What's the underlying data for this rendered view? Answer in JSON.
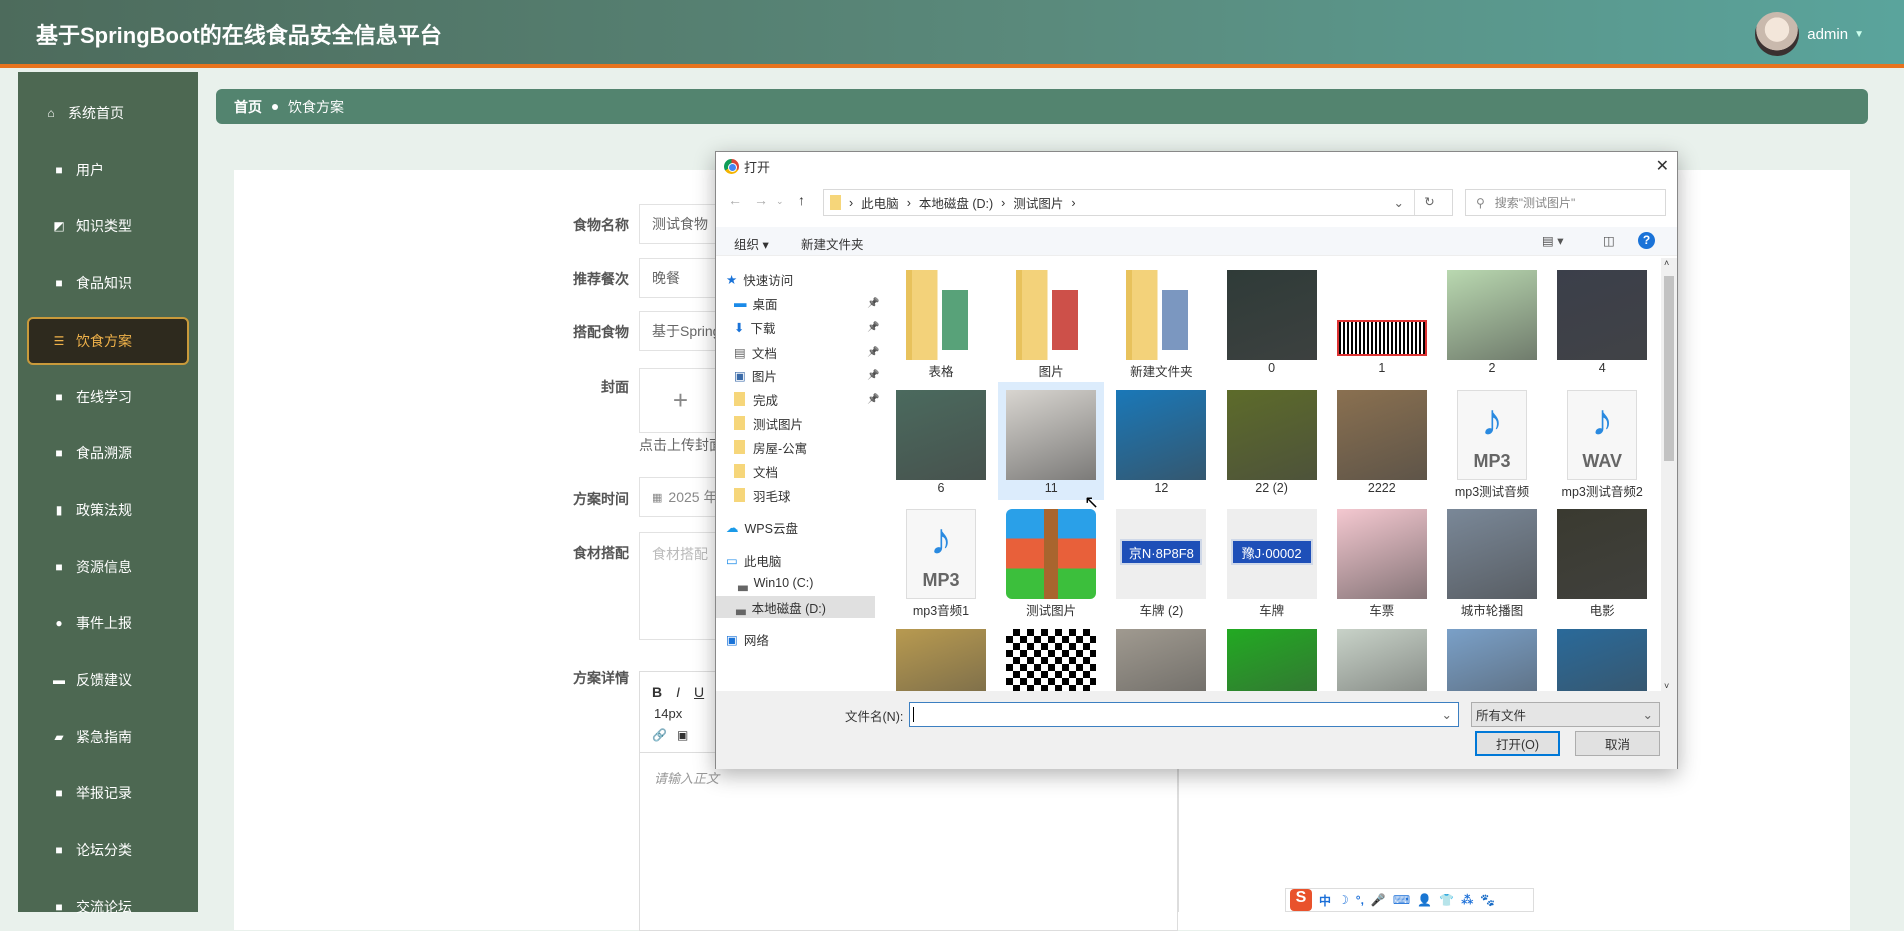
{
  "header": {
    "title": "基于SpringBoot的在线食品安全信息平台",
    "username": "admin"
  },
  "sidebar": {
    "items": [
      {
        "label": "系统首页",
        "icon": "home-icon"
      },
      {
        "label": "用户",
        "icon": "grid-icon"
      },
      {
        "label": "知识类型",
        "icon": "chart-icon"
      },
      {
        "label": "食品知识",
        "icon": "grid-icon"
      },
      {
        "label": "饮食方案",
        "icon": "sliders-icon",
        "active": true
      },
      {
        "label": "在线学习",
        "icon": "grid-icon"
      },
      {
        "label": "食品溯源",
        "icon": "grid-icon"
      },
      {
        "label": "政策法规",
        "icon": "book-icon"
      },
      {
        "label": "资源信息",
        "icon": "grid-icon"
      },
      {
        "label": "事件上报",
        "icon": "user-icon"
      },
      {
        "label": "反馈建议",
        "icon": "printer-icon"
      },
      {
        "label": "紧急指南",
        "icon": "briefcase-icon"
      },
      {
        "label": "举报记录",
        "icon": "grid-icon"
      },
      {
        "label": "论坛分类",
        "icon": "grid-icon"
      },
      {
        "label": "交流论坛",
        "icon": "grid-icon"
      }
    ]
  },
  "breadcrumb": {
    "home": "首页",
    "current": "饮食方案"
  },
  "form": {
    "food_name": {
      "label": "食物名称",
      "value": "测试食物"
    },
    "meal": {
      "label": "推荐餐次",
      "value": "晚餐"
    },
    "pairing": {
      "label": "搭配食物",
      "value": "基于Spring"
    },
    "cover": {
      "label": "封面",
      "hint": "点击上传封面"
    },
    "time": {
      "label": "方案时间",
      "value": "2025 年"
    },
    "ingredients": {
      "label": "食材搭配",
      "placeholder": "食材搭配"
    },
    "detail": {
      "label": "方案详情",
      "font_size": "14px",
      "placeholder": "请输入正文"
    }
  },
  "dialog": {
    "title": "打开",
    "path": [
      "此电脑",
      "本地磁盘 (D:)",
      "测试图片"
    ],
    "search_placeholder": "搜索\"测试图片\"",
    "organize": "组织 ▾",
    "new_folder": "新建文件夹",
    "nav": [
      {
        "label": "快速访问",
        "type": "star"
      },
      {
        "label": "桌面",
        "type": "desktop",
        "pin": true
      },
      {
        "label": "下载",
        "type": "download",
        "pin": true
      },
      {
        "label": "文档",
        "type": "doc",
        "pin": true
      },
      {
        "label": "图片",
        "type": "pic",
        "pin": true
      },
      {
        "label": "完成",
        "type": "folder",
        "pin": true
      },
      {
        "label": "测试图片",
        "type": "folder"
      },
      {
        "label": "房屋-公寓",
        "type": "folder"
      },
      {
        "label": "文档",
        "type": "folder"
      },
      {
        "label": "羽毛球",
        "type": "folder"
      },
      {
        "label": "WPS云盘",
        "type": "cloud"
      },
      {
        "label": "此电脑",
        "type": "pc"
      },
      {
        "label": "Win10 (C:)",
        "type": "drive"
      },
      {
        "label": "本地磁盘 (D:)",
        "type": "drive",
        "selected": true
      },
      {
        "label": "网络",
        "type": "net"
      }
    ],
    "files": [
      {
        "name": "表格",
        "kind": "folder",
        "color": "#2e8b57"
      },
      {
        "name": "图片",
        "kind": "folder",
        "color": "#c0241c"
      },
      {
        "name": "新建文件夹",
        "kind": "folder",
        "color": "#5a7db0"
      },
      {
        "name": "0",
        "kind": "photo",
        "color": "#2f3b38"
      },
      {
        "name": "1",
        "kind": "barcode",
        "color": "#ffffff"
      },
      {
        "name": "2",
        "kind": "photo",
        "color": "#b9d8b0"
      },
      {
        "name": "4",
        "kind": "photo",
        "color": "#3b3f4a"
      },
      {
        "name": "6",
        "kind": "photo",
        "color": "#4b6a5e"
      },
      {
        "name": "11",
        "kind": "photo",
        "color": "#d8d5d0",
        "selected": true
      },
      {
        "name": "12",
        "kind": "photo",
        "color": "#1a78b8"
      },
      {
        "name": "22 (2)",
        "kind": "photo",
        "color": "#5d6b2a"
      },
      {
        "name": "2222",
        "kind": "photo",
        "color": "#8a7050"
      },
      {
        "name": "mp3测试音频",
        "kind": "audio",
        "ext": "MP3"
      },
      {
        "name": "mp3测试音频2",
        "kind": "audio",
        "ext": "WAV"
      },
      {
        "name": "mp3音频1",
        "kind": "audio",
        "ext": "MP3"
      },
      {
        "name": "测试图片",
        "kind": "archive"
      },
      {
        "name": "车牌 (2)",
        "kind": "plate",
        "text": "京N·8P8F8"
      },
      {
        "name": "车牌",
        "kind": "plate",
        "text": "豫J·00002"
      },
      {
        "name": "车票",
        "kind": "photo",
        "color": "#f4c8d0"
      },
      {
        "name": "城市轮播图",
        "kind": "photo",
        "color": "#7a8898"
      },
      {
        "name": "电影",
        "kind": "photo",
        "color": "#3a3a30"
      },
      {
        "name": "",
        "kind": "photo",
        "color": "#b89a50"
      },
      {
        "name": "",
        "kind": "qr"
      },
      {
        "name": "",
        "kind": "photo",
        "color": "#a09a90"
      },
      {
        "name": "",
        "kind": "photo",
        "color": "#22aa22"
      },
      {
        "name": "",
        "kind": "photo",
        "color": "#c8d2c8"
      },
      {
        "name": "",
        "kind": "photo",
        "color": "#7aa0c8"
      },
      {
        "name": "",
        "kind": "photo",
        "color": "#2a6a9a"
      }
    ],
    "filename_label": "文件名(N):",
    "filename_value": "",
    "filter": "所有文件",
    "open": "打开(O)",
    "cancel": "取消"
  },
  "ime": {
    "items": [
      "中",
      "☽",
      "°,",
      "🎤",
      "⌨",
      "👤",
      "👕",
      "⁂",
      "🐾"
    ]
  }
}
